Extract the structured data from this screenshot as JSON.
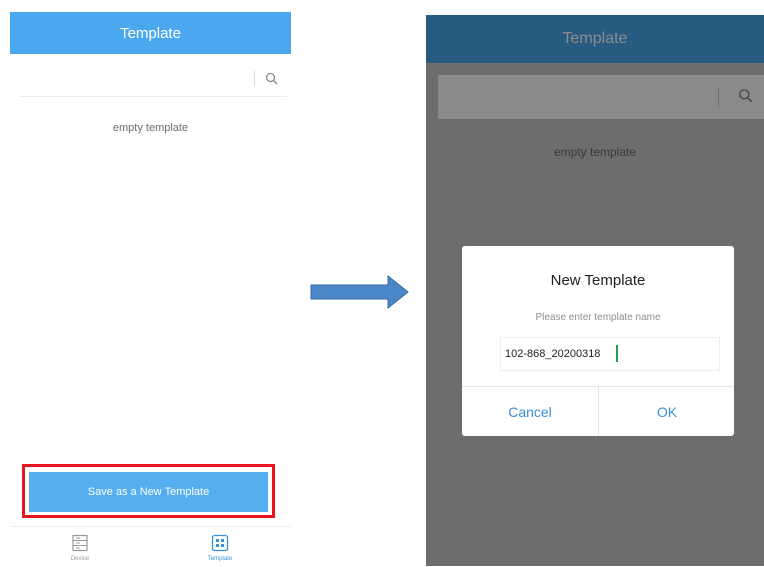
{
  "left_screen": {
    "header_title": "Template",
    "empty_text": "empty template",
    "save_button_label": "Save as a  New Template",
    "tabs": [
      {
        "label": "Device",
        "icon": "device-icon",
        "active": false
      },
      {
        "label": "Template",
        "icon": "template-icon",
        "active": true
      }
    ]
  },
  "right_screen": {
    "header_title": "Template",
    "empty_text": "empty template",
    "dialog": {
      "title": "New Template",
      "placeholder": "Please enter template name",
      "input_value": "102-868_20200318",
      "cancel_label": "Cancel",
      "ok_label": "OK"
    }
  },
  "colors": {
    "header": "#4ba8ef",
    "button": "#55aeef",
    "highlight": "#e8141e",
    "arrow": "#4a86c8",
    "accent": "#3b8fd9"
  }
}
